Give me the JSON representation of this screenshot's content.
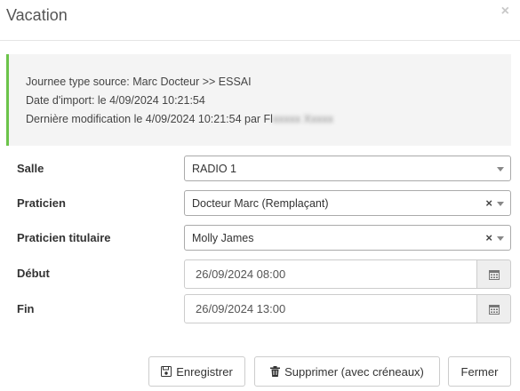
{
  "modal": {
    "title": "Vacation",
    "close_label": "×"
  },
  "info": {
    "source_line": "Journee type source: Marc Docteur >> ESSAI",
    "import_line": "Date d'import: le 4/09/2024 10:21:54",
    "modification_line": "Dernière modification le 4/09/2024 10:21:54 par Fl",
    "modification_user_redacted": "xxxxx Xxxxx"
  },
  "form": {
    "salle": {
      "label": "Salle",
      "value": "RADIO 1"
    },
    "praticien": {
      "label": "Praticien",
      "value": "Docteur Marc (Remplaçant)",
      "clear": "×"
    },
    "praticien_titulaire": {
      "label": "Praticien titulaire",
      "value": "Molly James",
      "clear": "×"
    },
    "debut": {
      "label": "Début",
      "value": "26/09/2024 08:00"
    },
    "fin": {
      "label": "Fin",
      "value": "26/09/2024 13:00"
    }
  },
  "buttons": {
    "save": "Enregistrer",
    "delete": "Supprimer (avec créneaux)",
    "close": "Fermer"
  },
  "icons": {
    "close": "close-icon",
    "dropdown": "chevron-down-icon",
    "calendar": "calendar-icon",
    "save": "floppy-disk-icon",
    "delete": "trash-icon"
  },
  "colors": {
    "info_accent": "#6cc44a",
    "info_background": "#f4f4f4"
  }
}
